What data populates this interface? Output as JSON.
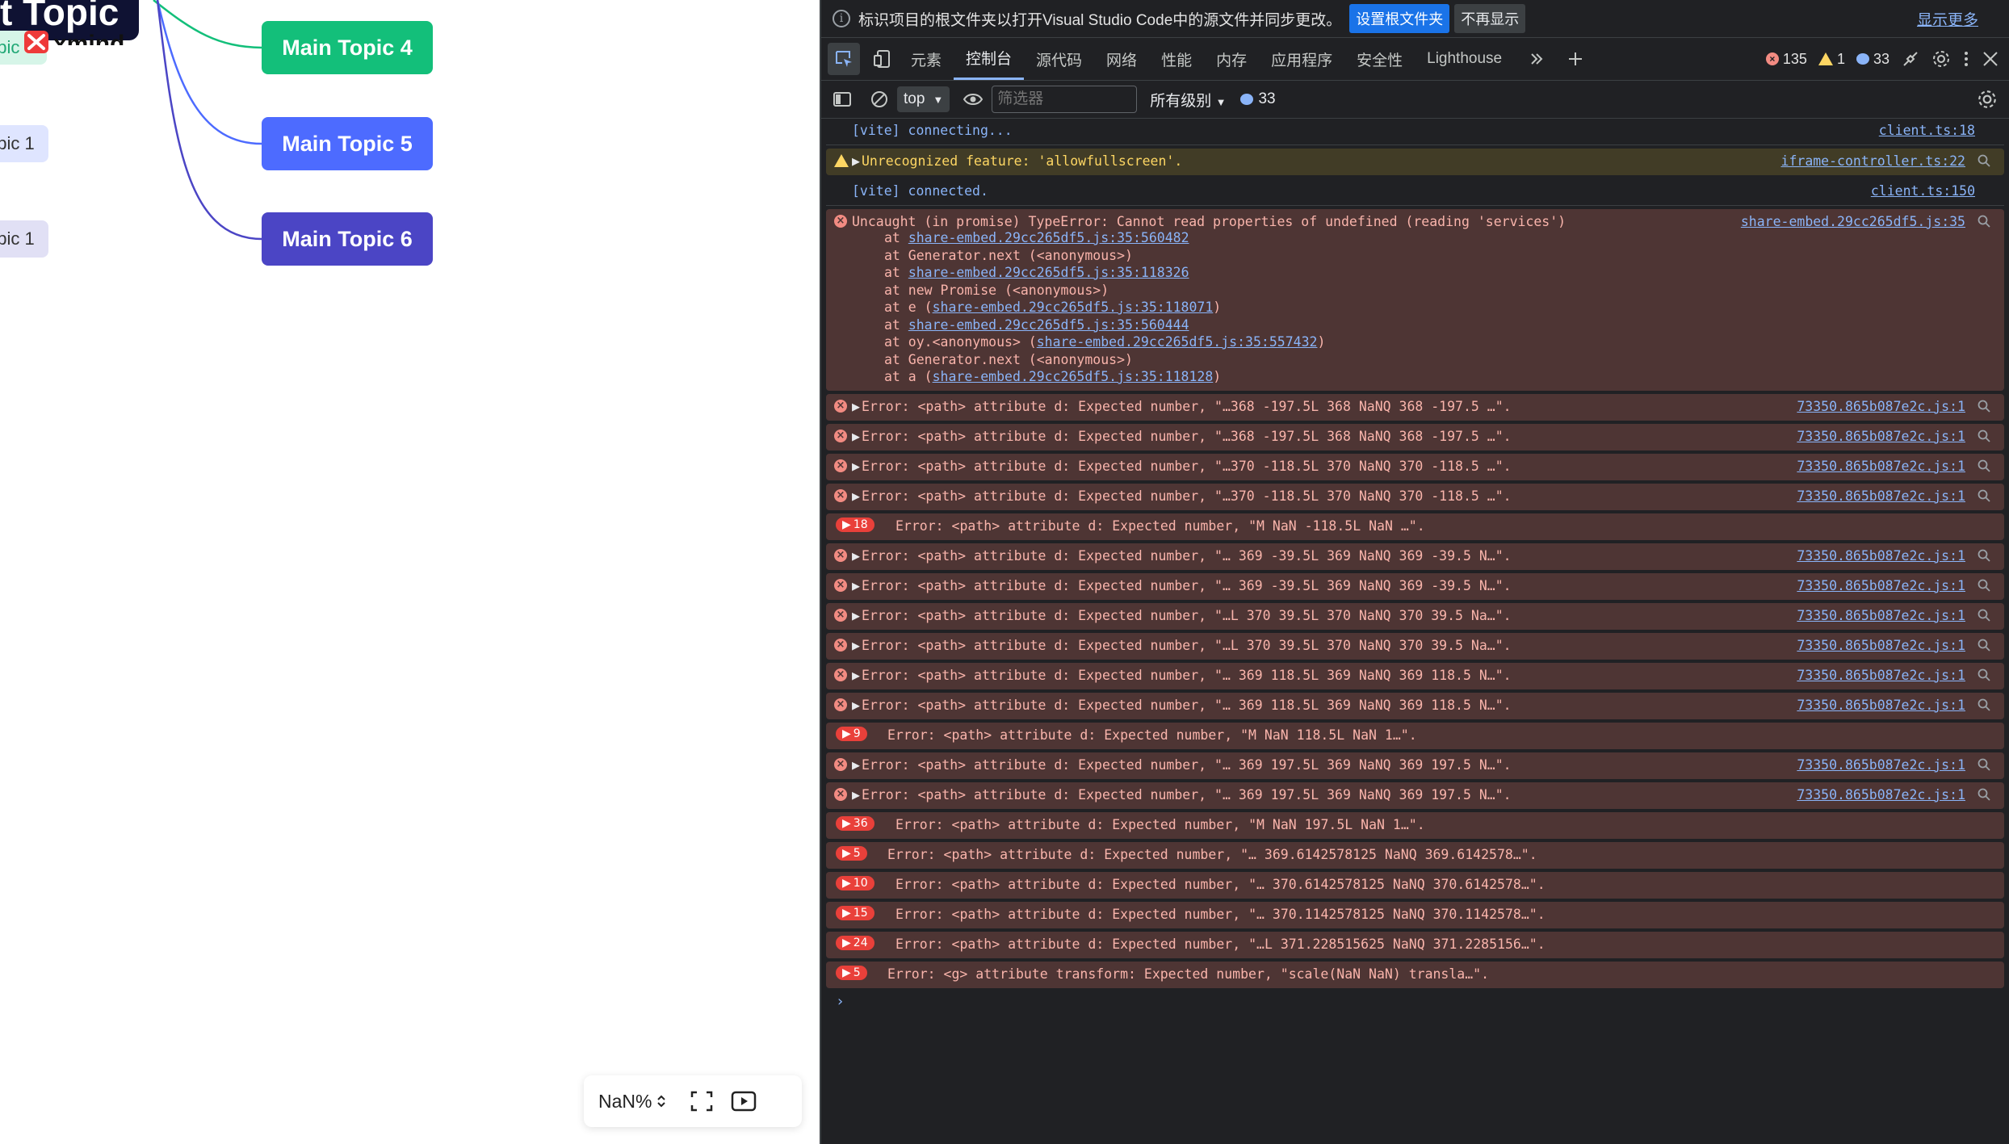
{
  "mindmap": {
    "central_label": "t Topic",
    "sub_green_label": "opic",
    "sub_blue1_label": "opic 1",
    "sub_blue2_label": "opic 1",
    "brand_text": "xmind",
    "topics": [
      "Main Topic 4",
      "Main Topic 5",
      "Main Topic 6"
    ],
    "colors": {
      "green": "#13bf7a",
      "blue": "#4d6bff",
      "indigo": "#4b45c5",
      "central": "#0f1233"
    },
    "zoom_label": "NaN%"
  },
  "devtools": {
    "infobar": {
      "text": "标识项目的根文件夹以打开Visual Studio Code中的源文件并同步更改。",
      "primary_btn": "设置根文件夹",
      "secondary_btn": "不再显示",
      "more_link": "显示更多"
    },
    "tabs": [
      "元素",
      "控制台",
      "源代码",
      "网络",
      "性能",
      "内存",
      "应用程序",
      "安全性",
      "Lighthouse"
    ],
    "active_tab": "控制台",
    "counts": {
      "errors": "135",
      "warnings": "1",
      "messages": "33"
    },
    "filter": {
      "context": "top",
      "placeholder": "筛选器",
      "levels": "所有级别",
      "msg_count": "33"
    },
    "rows": [
      {
        "type": "info",
        "text": "[vite] connecting...",
        "src": "client.ts:18"
      },
      {
        "type": "warn",
        "text": "Unrecognized feature: 'allowfullscreen'.",
        "src": "iframe-controller.ts:22"
      },
      {
        "type": "info",
        "text": "[vite] connected.",
        "src": "client.ts:150"
      },
      {
        "type": "error-stack",
        "text": "Uncaught (in promise) TypeError: Cannot read properties of undefined (reading 'services')",
        "src": "share-embed.29cc265df5.js:35",
        "stack": [
          [
            "at ",
            "share-embed.29cc265df5.js:35:560482",
            ""
          ],
          [
            "at Generator.next (<anonymous>)",
            "",
            ""
          ],
          [
            "at ",
            "share-embed.29cc265df5.js:35:118326",
            ""
          ],
          [
            "at new Promise (<anonymous>)",
            "",
            ""
          ],
          [
            "at e (",
            "share-embed.29cc265df5.js:35:118071",
            ")"
          ],
          [
            "at ",
            "share-embed.29cc265df5.js:35:560444",
            ""
          ],
          [
            "at oy.<anonymous> (",
            "share-embed.29cc265df5.js:35:557432",
            ")"
          ],
          [
            "at Generator.next (<anonymous>)",
            "",
            ""
          ],
          [
            "at a (",
            "share-embed.29cc265df5.js:35:118128",
            ")"
          ]
        ]
      },
      {
        "type": "error",
        "text": "Error: <path> attribute d: Expected number, \"…368 -197.5L 368 NaNQ 368 -197.5 …\".",
        "src": "73350.865b087e2c.js:1"
      },
      {
        "type": "error",
        "text": "Error: <path> attribute d: Expected number, \"…368 -197.5L 368 NaNQ 368 -197.5 …\".",
        "src": "73350.865b087e2c.js:1"
      },
      {
        "type": "error",
        "text": "Error: <path> attribute d: Expected number, \"…370 -118.5L 370 NaNQ 370 -118.5 …\".",
        "src": "73350.865b087e2c.js:1"
      },
      {
        "type": "error",
        "text": "Error: <path> attribute d: Expected number, \"…370 -118.5L 370 NaNQ 370 -118.5 …\".",
        "src": "73350.865b087e2c.js:1"
      },
      {
        "type": "group",
        "count": "18",
        "text": "Error: <path> attribute d: Expected number, \"M NaN -118.5L NaN …\"."
      },
      {
        "type": "error",
        "text": "Error: <path> attribute d: Expected number, \"… 369 -39.5L 369 NaNQ 369 -39.5 N…\".",
        "src": "73350.865b087e2c.js:1"
      },
      {
        "type": "error",
        "text": "Error: <path> attribute d: Expected number, \"… 369 -39.5L 369 NaNQ 369 -39.5 N…\".",
        "src": "73350.865b087e2c.js:1"
      },
      {
        "type": "error",
        "text": "Error: <path> attribute d: Expected number, \"…L 370 39.5L 370 NaNQ 370 39.5 Na…\".",
        "src": "73350.865b087e2c.js:1"
      },
      {
        "type": "error",
        "text": "Error: <path> attribute d: Expected number, \"…L 370 39.5L 370 NaNQ 370 39.5 Na…\".",
        "src": "73350.865b087e2c.js:1"
      },
      {
        "type": "error",
        "text": "Error: <path> attribute d: Expected number, \"… 369 118.5L 369 NaNQ 369 118.5 N…\".",
        "src": "73350.865b087e2c.js:1"
      },
      {
        "type": "error",
        "text": "Error: <path> attribute d: Expected number, \"… 369 118.5L 369 NaNQ 369 118.5 N…\".",
        "src": "73350.865b087e2c.js:1"
      },
      {
        "type": "group",
        "count": "9",
        "text": "Error: <path> attribute d: Expected number, \"M NaN 118.5L NaN 1…\"."
      },
      {
        "type": "error",
        "text": "Error: <path> attribute d: Expected number, \"… 369 197.5L 369 NaNQ 369 197.5 N…\".",
        "src": "73350.865b087e2c.js:1"
      },
      {
        "type": "error",
        "text": "Error: <path> attribute d: Expected number, \"… 369 197.5L 369 NaNQ 369 197.5 N…\".",
        "src": "73350.865b087e2c.js:1"
      },
      {
        "type": "group",
        "count": "36",
        "text": "Error: <path> attribute d: Expected number, \"M NaN 197.5L NaN 1…\"."
      },
      {
        "type": "group",
        "count": "5",
        "text": "Error: <path> attribute d: Expected number, \"… 369.6142578125 NaNQ 369.6142578…\"."
      },
      {
        "type": "group",
        "count": "10",
        "text": "Error: <path> attribute d: Expected number, \"… 370.6142578125 NaNQ 370.6142578…\"."
      },
      {
        "type": "group",
        "count": "15",
        "text": "Error: <path> attribute d: Expected number, \"… 370.1142578125 NaNQ 370.1142578…\"."
      },
      {
        "type": "group",
        "count": "24",
        "text": "Error: <path> attribute d: Expected number, \"…L 371.228515625 NaNQ 371.2285156…\"."
      },
      {
        "type": "group",
        "count": "5",
        "text": "Error: <g> attribute transform: Expected number, \"scale(NaN NaN) transla…\"."
      }
    ],
    "prompt": "›"
  }
}
